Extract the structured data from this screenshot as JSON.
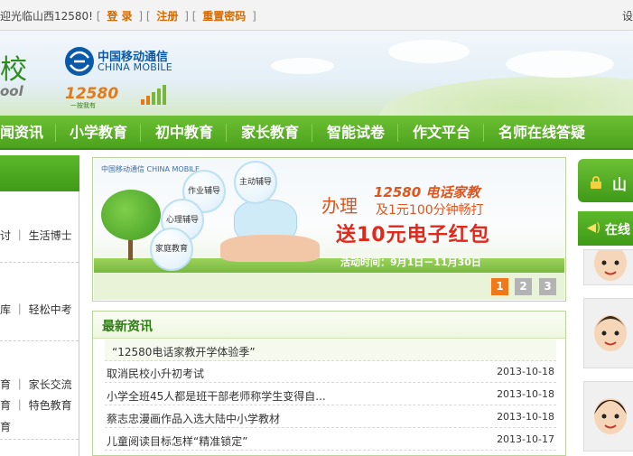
{
  "topbar": {
    "welcome": "迎光临山西12580!",
    "open_bracket": "[",
    "close_bracket": "]",
    "login": "登 录",
    "register": "注册",
    "reset_password": "重置密码",
    "settings": "设"
  },
  "header": {
    "site_char": "校",
    "site_en": "ool",
    "brand_cn": "中国移动通信",
    "brand_en": "CHINA MOBILE",
    "badge": "12580",
    "badge_sub": "一按我有"
  },
  "nav": {
    "items": [
      "闻资讯",
      "小学教育",
      "初中教育",
      "家长教育",
      "智能试卷",
      "作文平台",
      "名师在线答疑"
    ]
  },
  "left": {
    "lines": [
      "讨 ｜ 生活博士",
      "库 ｜ 轻松中考",
      "育 ｜ 家长交流",
      "育 ｜ 特色教育",
      "育"
    ]
  },
  "banner": {
    "brand": "中国移动通信 CHINA MOBILE",
    "bubbles": [
      "作业辅导",
      "主动辅导",
      "心理辅导",
      "家庭教育"
    ],
    "banli": "办理",
    "line1": "12580 电话家教",
    "line2": "及1元100分钟畅打",
    "line3": "送10元电子红包",
    "line4": "活动时间：9月1日－11月30日",
    "pages": [
      "1",
      "2",
      "3"
    ],
    "active_page": 1
  },
  "news": {
    "title": "最新资讯",
    "items": [
      {
        "title": "“12580电话家教开学体验季”",
        "date": ""
      },
      {
        "title": "取消民校小升初考试",
        "date": "2013-10-18"
      },
      {
        "title": "小学全班45人都是班干部老师称学生变得自...",
        "date": "2013-10-18"
      },
      {
        "title": "蔡志忠漫画作品入选大陆中小学教材",
        "date": "2013-10-18"
      },
      {
        "title": "儿童阅读目标怎样“精准锁定”",
        "date": "2013-10-17"
      }
    ]
  },
  "right": {
    "login_char": "山",
    "online": "在线"
  },
  "colors": {
    "nav_green": "#4ca21c",
    "accent_orange": "#f07818",
    "link_orange": "#d46a00",
    "title_green": "#2e7d14"
  }
}
